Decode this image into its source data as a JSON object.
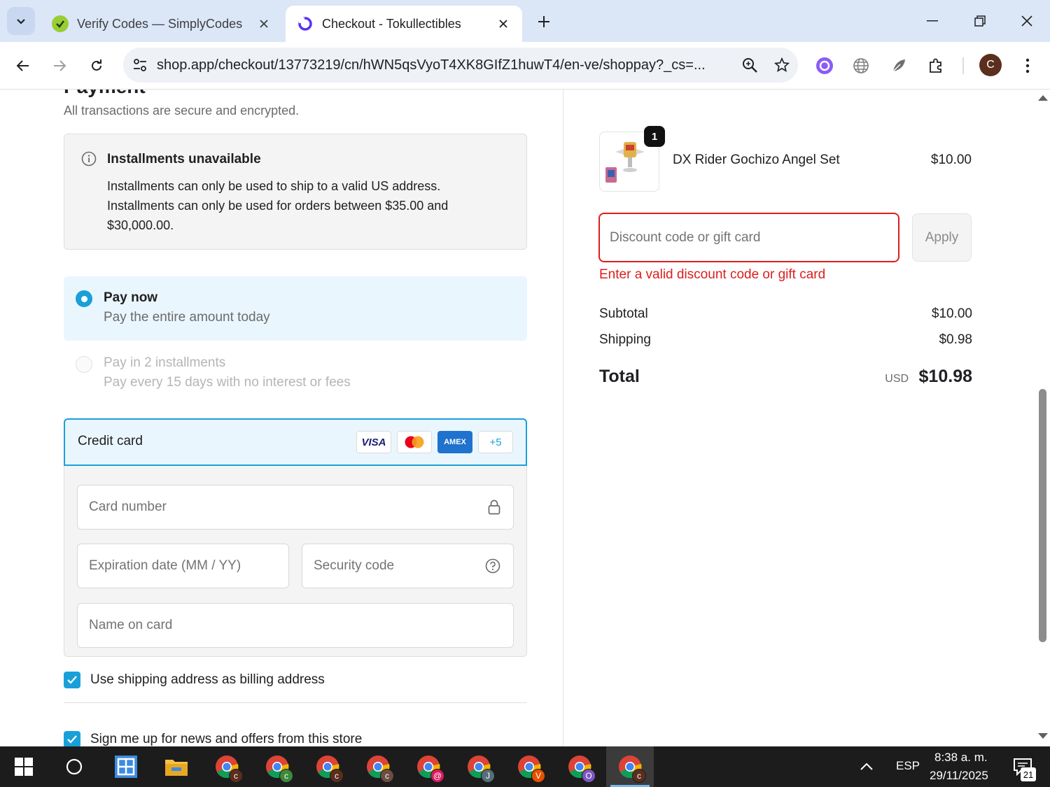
{
  "browser": {
    "tabs": [
      {
        "title": "Verify Codes — SimplyCodes",
        "active": false
      },
      {
        "title": "Checkout - Tokullectibles",
        "active": true
      }
    ],
    "url": "shop.app/checkout/13773219/cn/hWN5qsVyoT4XK8GIfZ1huwT4/en-ve/shoppay?_cs=...",
    "avatar_letter": "C"
  },
  "payment": {
    "heading": "Payment",
    "secure_text": "All transactions are secure and encrypted.",
    "installments_notice": {
      "title": "Installments unavailable",
      "line1": "Installments can only be used to ship to a valid US address.",
      "line2": "Installments can only be used for orders between $35.00 and $30,000.00."
    },
    "options": [
      {
        "title": "Pay now",
        "subtitle": "Pay the entire amount today",
        "selected": true
      },
      {
        "title": "Pay in 2 installments",
        "subtitle": "Pay every 15 days with no interest or fees",
        "selected": false,
        "disabled": true
      }
    ],
    "credit_card": {
      "label": "Credit card",
      "brands": [
        "VISA",
        "mastercard",
        "AMEX"
      ],
      "more_brands": "+5",
      "card_number_placeholder": "Card number",
      "expiration_placeholder": "Expiration date (MM / YY)",
      "security_placeholder": "Security code",
      "name_placeholder": "Name on card"
    },
    "billing_checkbox": {
      "label": "Use shipping address as billing address",
      "checked": true
    },
    "newsletter_checkbox": {
      "label": "Sign me up for news and offers from this store",
      "checked": true
    }
  },
  "summary": {
    "item": {
      "name": "DX Rider Gochizo Angel Set",
      "price": "$10.00",
      "quantity": "1"
    },
    "discount_placeholder": "Discount code or gift card",
    "apply_label": "Apply",
    "discount_error": "Enter a valid discount code or gift card",
    "subtotal_label": "Subtotal",
    "subtotal_value": "$10.00",
    "shipping_label": "Shipping",
    "shipping_value": "$0.98",
    "total_label": "Total",
    "currency": "USD",
    "total_value": "$10.98"
  },
  "taskbar": {
    "language": "ESP",
    "time": "8:38 a. m.",
    "date": "29/11/2025",
    "notifications": "21",
    "chrome_profiles": [
      "c",
      "c",
      "c",
      "c",
      "@",
      "J",
      "V",
      "O",
      "c"
    ]
  },
  "colors": {
    "accent": "#1aa0d8",
    "error": "#dd1d1d"
  }
}
